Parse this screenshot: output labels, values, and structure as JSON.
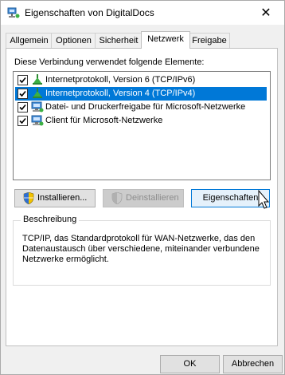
{
  "window": {
    "title": "Eigenschaften von DigitalDocs",
    "close_glyph": "✕"
  },
  "tabs": [
    "Allgemein",
    "Optionen",
    "Sicherheit",
    "Netzwerk",
    "Freigabe"
  ],
  "active_tab": "Netzwerk",
  "connection_label": "Diese Verbindung verwendet folgende Elemente:",
  "items": [
    {
      "label": "Internetprotokoll, Version 6 (TCP/IPv6)",
      "checked": true,
      "selected": false,
      "icon": "network-protocol-icon"
    },
    {
      "label": "Internetprotokoll, Version 4 (TCP/IPv4)",
      "checked": true,
      "selected": true,
      "icon": "network-protocol-icon"
    },
    {
      "label": "Datei- und Druckerfreigabe für Microsoft-Netzwerke",
      "checked": true,
      "selected": false,
      "icon": "network-service-icon"
    },
    {
      "label": "Client für Microsoft-Netzwerke",
      "checked": true,
      "selected": false,
      "icon": "network-client-icon"
    }
  ],
  "buttons": {
    "install": "Installieren...",
    "uninstall": "Deinstallieren",
    "properties": "Eigenschaften",
    "ok": "OK",
    "cancel": "Abbrechen"
  },
  "description": {
    "title": "Beschreibung",
    "text": "TCP/IP, das Standardprotokoll für WAN-Netzwerke, das den Datenaustausch über verschiedene, miteinander verbundene Netzwerke ermöglicht."
  },
  "colors": {
    "selection": "#0078d7",
    "focus_border": "#0078d7"
  }
}
